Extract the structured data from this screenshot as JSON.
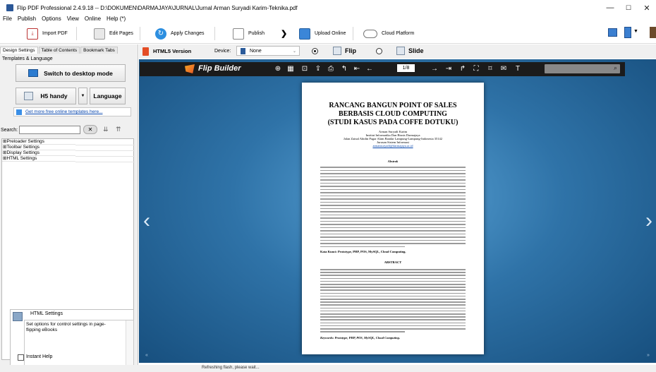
{
  "window": {
    "title": "Flip PDF Professional 2.4.9.18 -- D:\\DOKUMEN\\DARMAJAYA\\JURNAL\\Jurnal Arman Suryadi Karim-Teknika.pdf",
    "minimize": "—",
    "maximize": "☐",
    "close": "✕"
  },
  "menu": [
    "File",
    "Publish",
    "Options",
    "View",
    "Online",
    "Help (*)"
  ],
  "toolbar": {
    "import_pdf": "Import PDF",
    "edit_pages": "Edit Pages",
    "apply_changes": "Apply Changes",
    "publish": "Publish",
    "arrow": "❯",
    "upload_online": "Upload Online",
    "cloud_platform": "Cloud Platform"
  },
  "left": {
    "tabs": [
      "Design Settings",
      "Table of Contents",
      "Bookmark Tabs"
    ],
    "templates_label": "Templates & Language",
    "switch_mode": "Switch to desktop mode",
    "h5_handy": "H5 handy",
    "dropdown_arrow": "▼",
    "language": "Language",
    "more_templates": "Get more free online templates here...",
    "search_label": "Search:",
    "search_value": "",
    "tree": [
      "⊞Preloader Settings",
      "⊞Toolbar Settings",
      "⊞Display Settings",
      "⊞HTML Settings"
    ],
    "help_title": "HTML Settings",
    "help_text": "Set options for control settings in page-flipping eBooks",
    "instant_help": "Instant Help"
  },
  "version_bar": {
    "version": "HTML5 Version",
    "device_label": "Device:",
    "device_value": "None",
    "flip": "Flip",
    "slide": "Slide"
  },
  "viewer": {
    "brand": "Flip Builder",
    "page_indicator": "1/8",
    "status": "Refreshing flash, please wait..."
  },
  "paper": {
    "title1": "RANCANG BANGUN POINT OF SALES",
    "title2": "BERBASIS CLOUD COMPUTING",
    "title3": "(STUDI KASUS PADA COFFE DOTUKU)",
    "author": "Arman Suryadi Karim",
    "inst": "Institut Informatika Dan Bisnis Darmajaya",
    "address": "Jalan Zainal Abidin Pagar Alam Bandar Lampung-Lampung-Indonesia 35142",
    "dept": "Jurusan Sistem Informasi",
    "email": "armansuryadi@darmajaya.ac.id",
    "abstrak": "Abstrak",
    "kata_kunci": "Kata Kunci: Prototype, PHP, POS, MySQL, Cloud Computing.",
    "abstract": "ABSTRACT",
    "keywords": "Keywords: Prototype, PHP, POS, MySQL, Cloud Computing."
  },
  "colors": {
    "accent_blue": "#2b7bd0",
    "viewer_bg": "#2f73a8",
    "link": "#0645ad"
  }
}
